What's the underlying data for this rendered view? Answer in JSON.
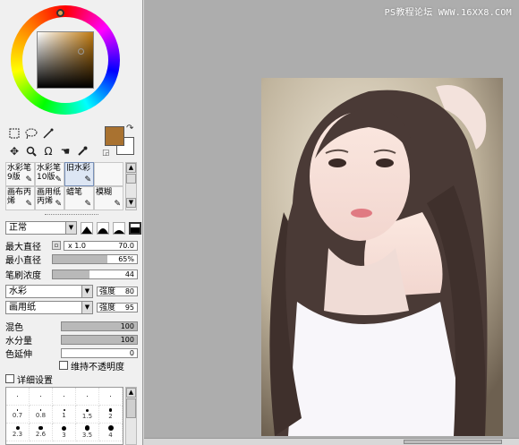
{
  "colors": {
    "main": "#a97230",
    "sub": "#ffffff",
    "accent": "#7890b8"
  },
  "watermark": "PS教程论坛 WWW.16XX8.COM",
  "brushes": [
    {
      "label": "水彩笔9版",
      "selected": false
    },
    {
      "label": "水彩笔10版",
      "selected": false
    },
    {
      "label": "旧水彩",
      "selected": true
    },
    {
      "label": "",
      "selected": false
    },
    {
      "label": "画布丙烯",
      "selected": false
    },
    {
      "label": "画用纸丙烯",
      "selected": false
    },
    {
      "label": "蜡笔",
      "selected": false
    },
    {
      "label": "模糊",
      "selected": false
    }
  ],
  "blend_mode": "正常",
  "params": {
    "max_diameter": {
      "label": "最大直径",
      "multiplier": "x 1.0",
      "value": "70.0"
    },
    "min_diameter": {
      "label": "最小直径",
      "value": "65%",
      "level": 0.65
    },
    "density": {
      "label": "笔刷浓度",
      "value": "44",
      "level": 0.44
    },
    "texture1": {
      "select": "水彩",
      "strength_label": "强度",
      "strength": "80"
    },
    "texture2": {
      "select": "画用纸",
      "strength_label": "强度",
      "strength": "95"
    },
    "blend": {
      "label": "混色",
      "value": "100",
      "level": 1.0
    },
    "water": {
      "label": "水分量",
      "value": "100",
      "level": 1.0
    },
    "extend": {
      "label": "色延伸",
      "value": "0",
      "level": 0.0
    },
    "keep_opacity": "维持不透明度",
    "details": "详细设置"
  },
  "sizes": [
    [
      "",
      "",
      "",
      "",
      ""
    ],
    [
      "0.7",
      "0.8",
      "1",
      "1.5",
      "2"
    ],
    [
      "2.3",
      "2.6",
      "3",
      "3.5",
      "4"
    ]
  ]
}
